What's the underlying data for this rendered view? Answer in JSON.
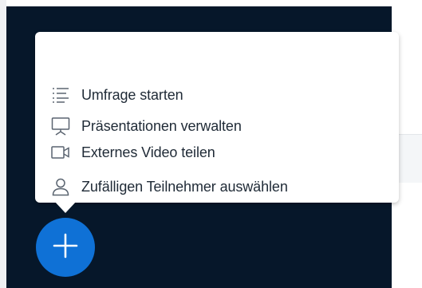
{
  "colors": {
    "stage_background": "#06172a",
    "menu_background": "#ffffff",
    "menu_text": "#1f2a36",
    "icon_stroke": "#5a6470",
    "fab_background": "#0f71d6"
  },
  "actions_menu": {
    "items": [
      {
        "label": "Umfrage starten",
        "icon": "poll-list-icon"
      },
      {
        "label": "Präsentationen verwalten",
        "icon": "presentation-icon"
      },
      {
        "label": "Externes Video teilen",
        "icon": "video-camera-icon"
      },
      {
        "label": "Zufälligen Teilnehmer auswählen",
        "icon": "user-icon"
      }
    ]
  },
  "fab": {
    "icon": "plus-icon"
  }
}
